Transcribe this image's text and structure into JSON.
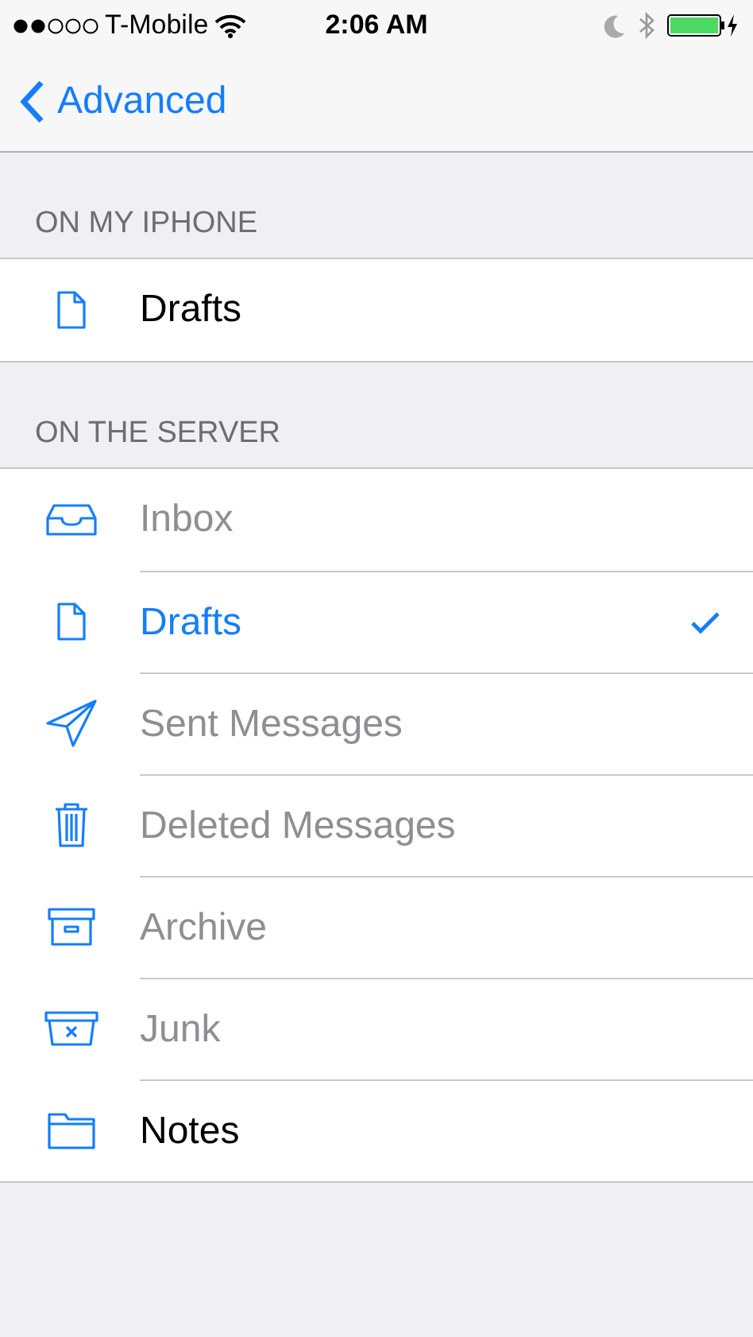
{
  "status_bar": {
    "carrier": "T-Mobile",
    "time": "2:06 AM"
  },
  "nav": {
    "back": "Advanced"
  },
  "sections": [
    {
      "header": "ON MY IPHONE",
      "items": [
        {
          "label": "Drafts",
          "kind": "draft",
          "selected": false,
          "disabled": false
        }
      ]
    },
    {
      "header": "ON THE SERVER",
      "items": [
        {
          "label": "Inbox",
          "kind": "inbox",
          "selected": false,
          "disabled": true
        },
        {
          "label": "Drafts",
          "kind": "draft",
          "selected": true,
          "disabled": false
        },
        {
          "label": "Sent Messages",
          "kind": "sent",
          "selected": false,
          "disabled": true
        },
        {
          "label": "Deleted Messages",
          "kind": "trash",
          "selected": false,
          "disabled": true
        },
        {
          "label": "Archive",
          "kind": "archive",
          "selected": false,
          "disabled": true
        },
        {
          "label": "Junk",
          "kind": "junk",
          "selected": false,
          "disabled": true
        },
        {
          "label": "Notes",
          "kind": "folder",
          "selected": false,
          "disabled": false
        }
      ]
    }
  ]
}
